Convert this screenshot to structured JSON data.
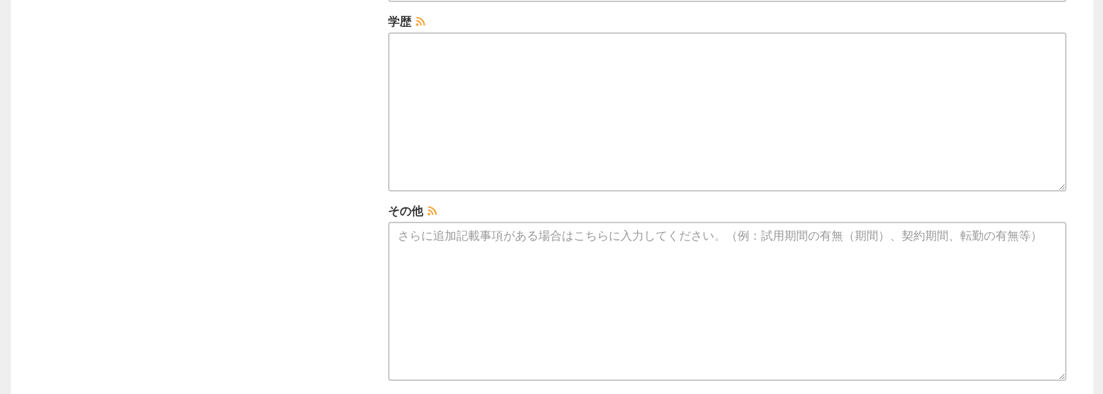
{
  "fields": [
    {
      "label": "学歴",
      "feed": true
    },
    {
      "label": "その他",
      "feed": true,
      "placeholder": "さらに追加記載事項がある場合はこちらに入力してください。（例：試用期間の有無（期間）、契約期間、転勤の有無等）"
    }
  ]
}
